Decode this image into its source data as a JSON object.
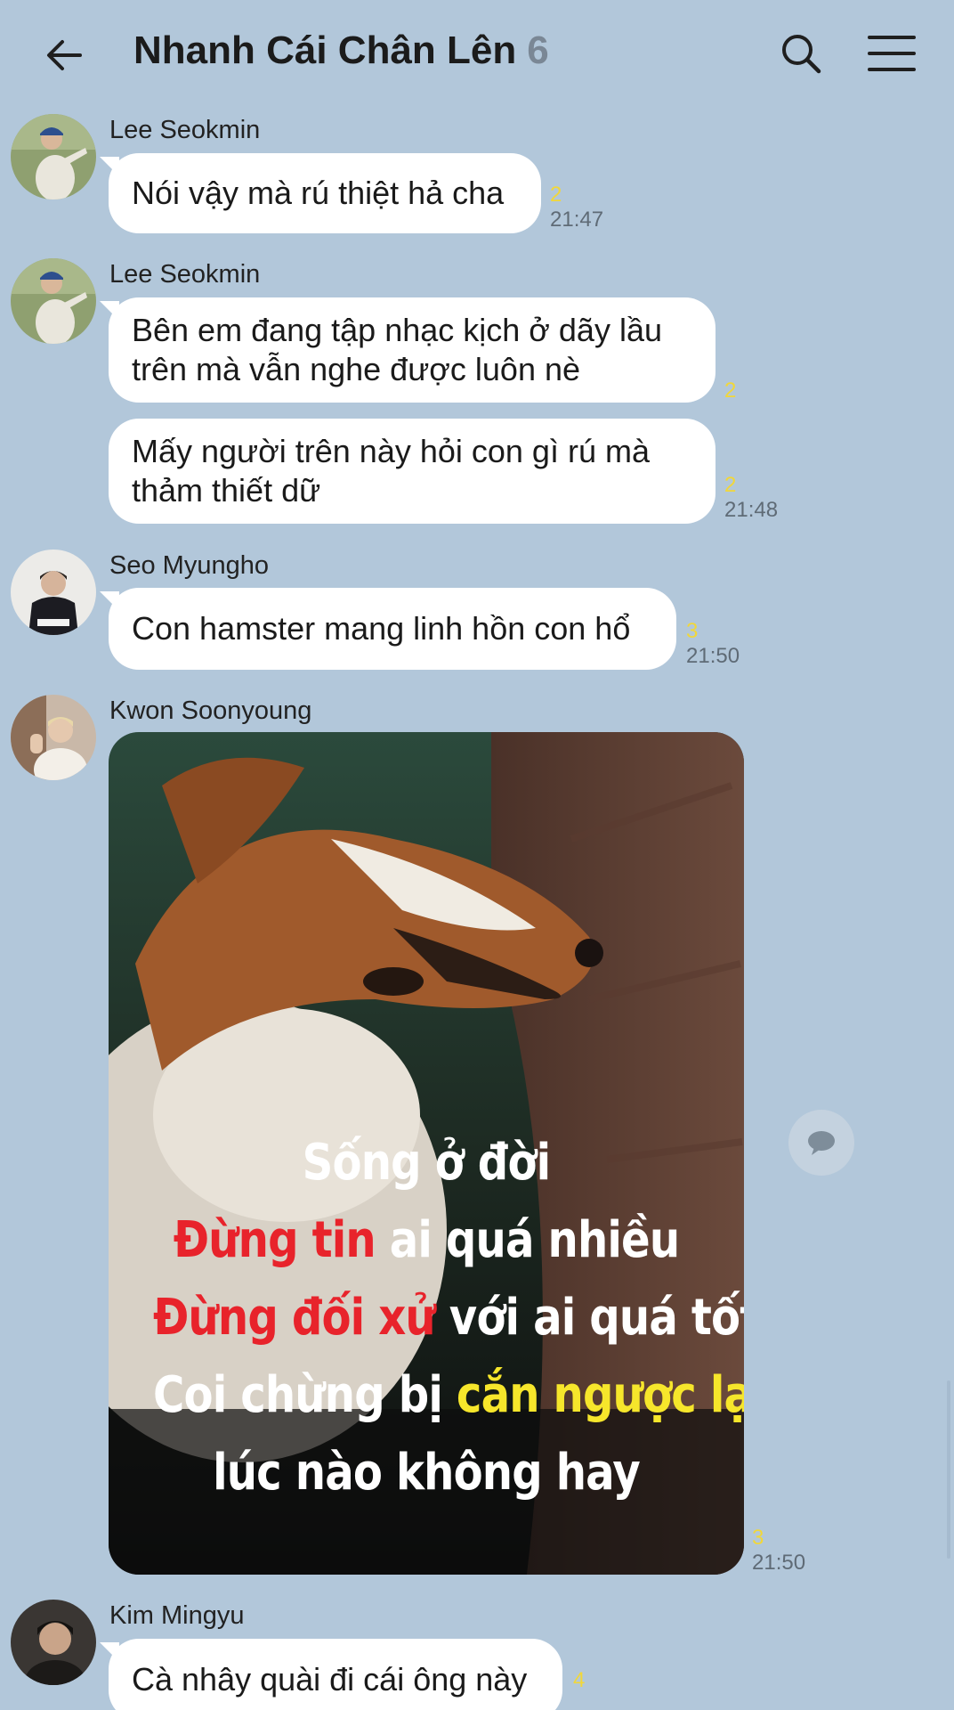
{
  "header": {
    "title": "Nhanh Cái Chân Lên",
    "member_count": "6",
    "back_icon": "arrow-left-icon",
    "search_icon": "search-icon",
    "menu_icon": "hamburger-menu-icon"
  },
  "messages": [
    {
      "sender": "Lee Seokmin",
      "text": "Nói vậy mà rú thiệt hả cha",
      "unread": "2",
      "time": "21:47"
    },
    {
      "sender": "Lee Seokmin",
      "text_lines": [
        "Bên em đang tập nhạc kịch ở dãy lầu",
        "trên mà vẫn nghe được luôn nè"
      ],
      "unread": "2"
    },
    {
      "text_lines": [
        "Mấy người trên này hỏi con gì rú mà",
        "thảm thiết dữ"
      ],
      "unread": "2",
      "time": "21:48"
    },
    {
      "sender": "Seo Myungho",
      "text": "Con hamster mang linh hồn con hổ",
      "unread": "3",
      "time": "21:50"
    },
    {
      "sender": "Kwon Soonyoung",
      "image": {
        "subject": "dog biting couch",
        "lines": [
          [
            {
              "t": "Sống ở đời",
              "c": "white"
            }
          ],
          [
            {
              "t": "Đừng tin",
              "c": "red"
            },
            {
              "t": " ai quá nhiều",
              "c": "white"
            }
          ],
          [
            {
              "t": "Đừng đối xử",
              "c": "red"
            },
            {
              "t": " với ai quá tốt",
              "c": "white"
            }
          ],
          [
            {
              "t": "Coi chừng bị ",
              "c": "white"
            },
            {
              "t": "cắn ngược lại",
              "c": "yellow"
            }
          ],
          [
            {
              "t": "lúc nào không hay",
              "c": "white"
            }
          ]
        ]
      },
      "unread": "3",
      "time": "21:50"
    },
    {
      "sender": "Kim Mingyu",
      "text": "Cà nhây quài đi cái ông này",
      "unread": "4"
    }
  ],
  "colors": {
    "background": "#b2c7da",
    "bubble": "#ffffff",
    "unread": "#f1d73a",
    "time": "#5f6b76",
    "meme_red": "#e8232b",
    "meme_yellow": "#f6e62b"
  }
}
